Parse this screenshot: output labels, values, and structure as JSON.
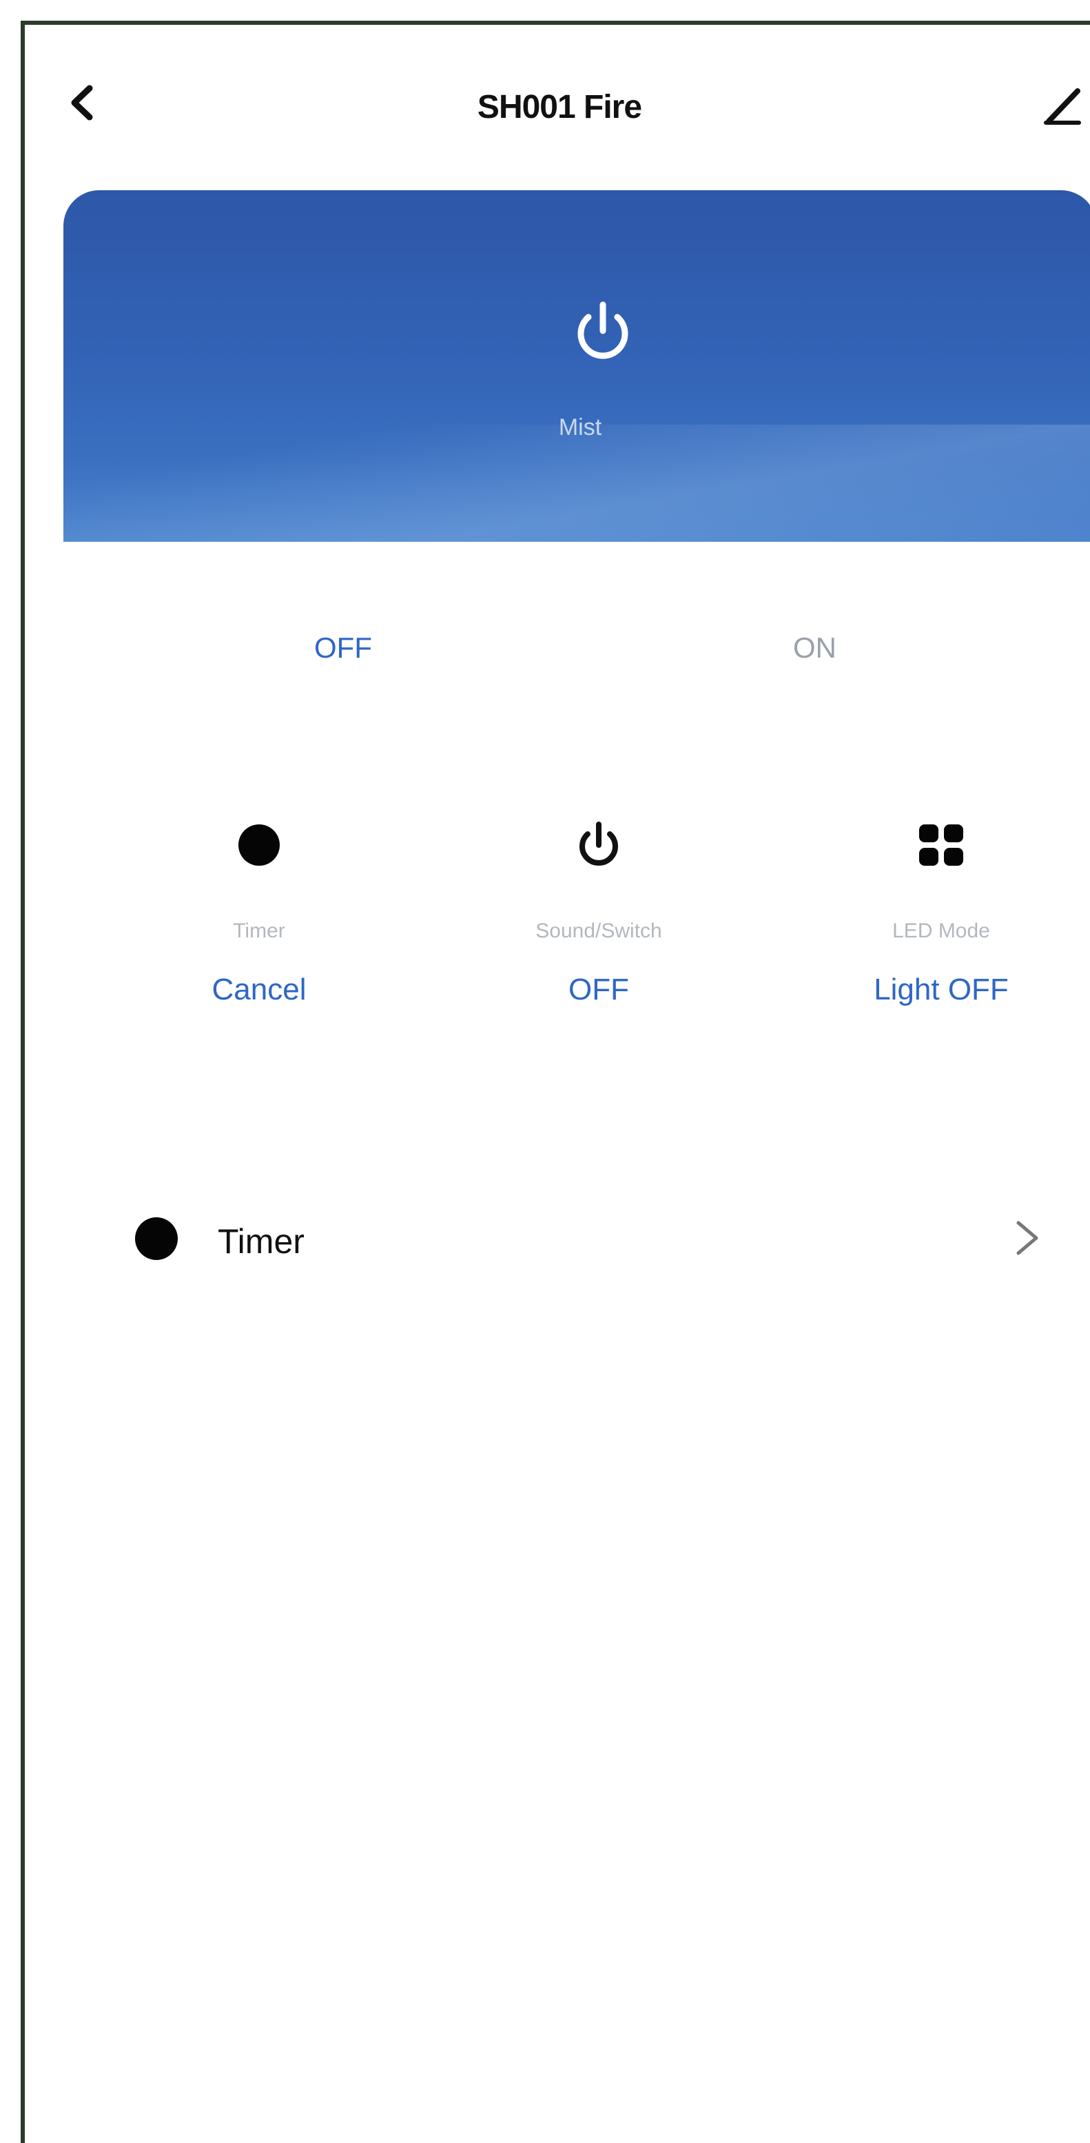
{
  "header": {
    "title": "SH001 Fire",
    "back_icon": "chevron-left-icon",
    "edit_icon": "pencil-icon"
  },
  "hero": {
    "icon": "power-icon",
    "label": "Mist",
    "colors": {
      "top": "#2e57a8",
      "bottom": "#4a82cc"
    }
  },
  "mode_toggle": {
    "options": [
      "OFF",
      "ON"
    ],
    "selected": "OFF",
    "accent": "#2e66c7"
  },
  "functions": [
    {
      "icon": "dot-icon",
      "label": "Timer",
      "value": "Cancel"
    },
    {
      "icon": "power-icon",
      "label": "Sound/Switch",
      "value": "OFF"
    },
    {
      "icon": "grid-icon",
      "label": "LED Mode",
      "value": "Light OFF"
    }
  ],
  "list": [
    {
      "icon": "dot-icon",
      "label": "Timer",
      "chevron": "chevron-right-icon"
    }
  ]
}
